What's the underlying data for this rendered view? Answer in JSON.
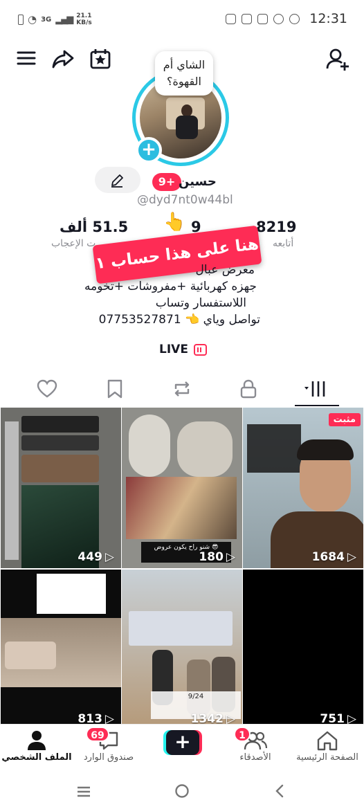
{
  "status_bar": {
    "network": "3G",
    "speed": "21.1",
    "speed_unit": "KB/s",
    "time": "12:31"
  },
  "profile": {
    "bubble_text": "الشاي أم القهوة؟",
    "name": "حسين",
    "notif_badge": "9+",
    "handle": "@dyd7nt0w44bl",
    "stats": {
      "following_count": "8219",
      "following_label": "أتابعه",
      "followers_count": "9",
      "likes_count": "51.5 ألف",
      "likes_label": "ت الإعجاب"
    },
    "banner_text": "هنا على هذا حساب ١",
    "bio_lines": [
      "معرض عبال",
      "جهزه كهربائية +مفروشات +تخومه",
      "اللاستفسار وتساب",
      "تواصل وياي 👈 07753527871"
    ],
    "live_label": "LIVE"
  },
  "grid": [
    {
      "views": "449",
      "pinned": false,
      "scene": "stoves"
    },
    {
      "views": "180",
      "pinned": false,
      "scene": "rugs",
      "caption": "😎 شنو راح يكون عروض"
    },
    {
      "views": "1684",
      "pinned": true,
      "pinned_label": "مثبت",
      "scene": "man"
    },
    {
      "views": "813",
      "pinned": false,
      "scene": "sofas"
    },
    {
      "views": "1342",
      "pinned": false,
      "scene": "people",
      "caption": "9/24"
    },
    {
      "views": "751",
      "pinned": false,
      "scene": "dark"
    }
  ],
  "bottom_nav": {
    "home_label": "الصفحة الرئيسية",
    "friends_label": "الأصدقاء",
    "friends_badge": "1",
    "inbox_label": "صندوق الوارد",
    "inbox_badge": "69",
    "profile_label": "الملف الشخصي"
  },
  "colors": {
    "accent": "#fe2c55",
    "ring": "#2bc9e6"
  }
}
